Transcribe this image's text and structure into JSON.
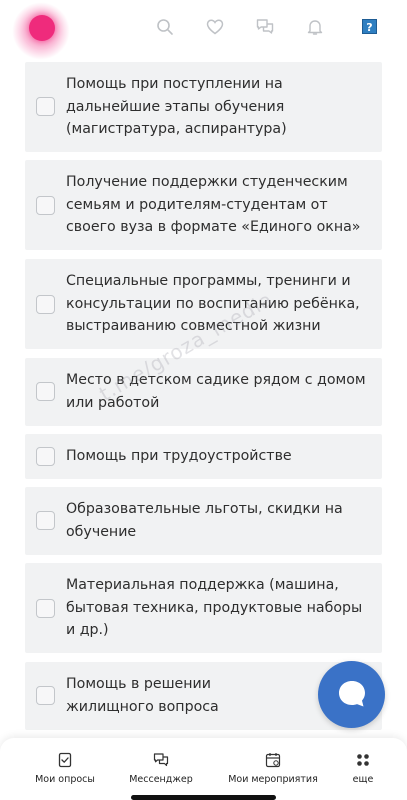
{
  "header": {
    "icons": [
      "search-icon",
      "heart-icon",
      "chat-icon",
      "bell-icon"
    ],
    "help_label": "?",
    "colors": {
      "logo": "#ef2b7c",
      "help": "#2f7fc1"
    }
  },
  "items": [
    {
      "label": "Помощь при поступлении на дальнейшие этапы обучения (магистратура, аспирантура)",
      "checked": false
    },
    {
      "label": "Получение поддержки студенческим семьям и родителям-студентам от своего вуза в формате «Единого окна»",
      "checked": false
    },
    {
      "label": "Специальные программы, тренинги и консультации по воспитанию ребёнка, выстраиванию совместной жизни",
      "checked": false
    },
    {
      "label": "Место в детском садике рядом с домом или работой",
      "checked": false
    },
    {
      "label": "Помощь при трудоустройстве",
      "checked": false
    },
    {
      "label": "Образовательные льготы, скидки на обучение",
      "checked": false
    },
    {
      "label": "Материальная поддержка (машина, бытовая техника, продуктовые наборы и др.)",
      "checked": false
    },
    {
      "label": "Помощь в решении жилищного вопроса",
      "checked": false
    }
  ],
  "watermark": "t.me/groza_media",
  "fab": {
    "icon": "chat-bubble-icon",
    "color": "#3a72c7"
  },
  "bottom_nav": [
    {
      "label": "Мои опросы",
      "icon": "poll-icon"
    },
    {
      "label": "Мессенджер",
      "icon": "messenger-icon"
    },
    {
      "label": "Мои мероприятия",
      "icon": "calendar-icon"
    },
    {
      "label": "еще",
      "icon": "more-grid-icon"
    }
  ]
}
